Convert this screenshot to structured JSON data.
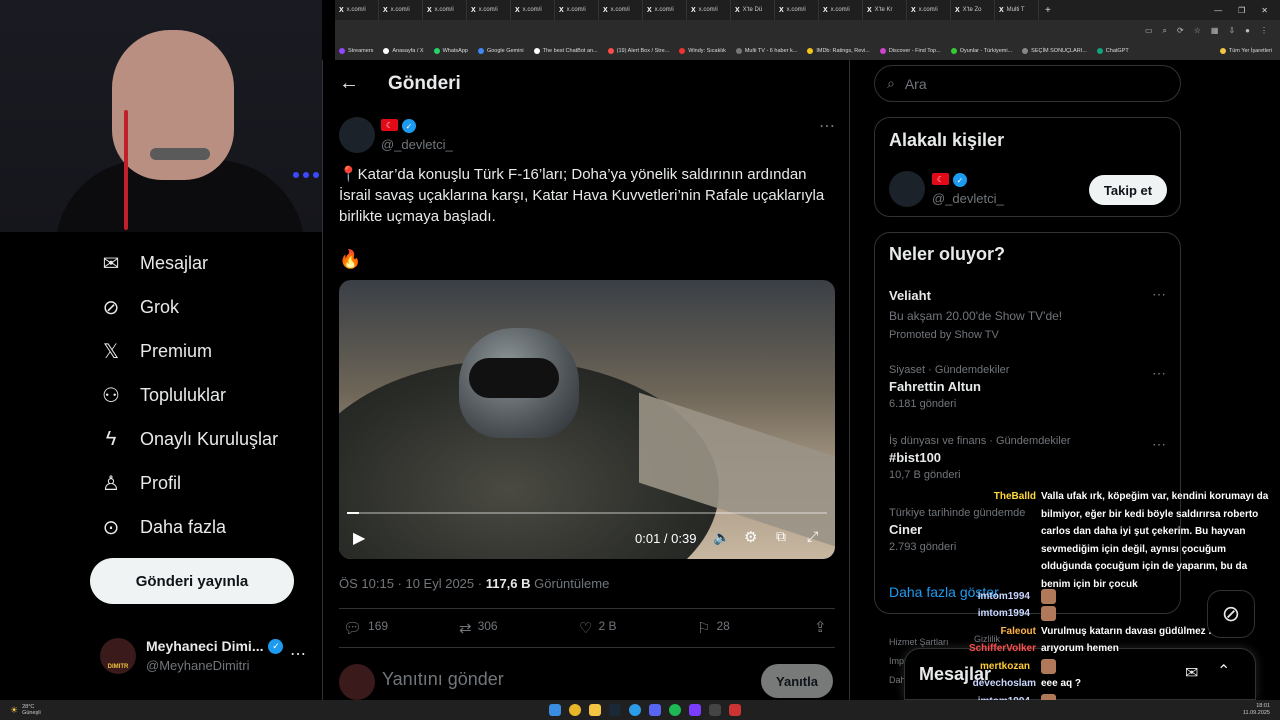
{
  "browser": {
    "tabs": [
      "x.com/i",
      "x.com/i",
      "x.com/i",
      "x.com/i",
      "x.com/i",
      "x.com/i",
      "x.com/i",
      "x.com/i",
      "x.com/i",
      "X'te Dü",
      "x.com/i",
      "x.com/i",
      "X'te Kr",
      "x.com/i",
      "X'te Zo",
      "Multi T"
    ],
    "bookmarks": [
      "Streamers",
      "Anasayfa / X",
      "WhatsApp",
      "Google Gemini",
      "The best ChatBot an...",
      "(19) Alert Box / Stre...",
      "Windy: Sıcaklık",
      "Multi TV - 6 haber k...",
      "IMDb: Ratings, Revi...",
      "Discover - Find Top...",
      "Oyunlar - Türkiyemi...",
      "SEÇİM SONUÇLARI...",
      "ChatGPT",
      "Tüm Yer İşaretleri"
    ]
  },
  "nav": {
    "items": [
      {
        "label": "Mesajlar",
        "icon": "envelope-icon"
      },
      {
        "label": "Grok",
        "icon": "grok-icon"
      },
      {
        "label": "Premium",
        "icon": "x-logo-icon"
      },
      {
        "label": "Topluluklar",
        "icon": "communities-icon"
      },
      {
        "label": "Onaylı Kuruluşlar",
        "icon": "lightning-icon"
      },
      {
        "label": "Profil",
        "icon": "person-icon"
      },
      {
        "label": "Daha fazla",
        "icon": "more-circle-icon"
      }
    ],
    "post_button": "Gönderi yayınla",
    "profile": {
      "name": "Meyhaneci Dimi...",
      "handle": "@MeyhaneDimitri",
      "avatar_text": "DIMITR"
    }
  },
  "main": {
    "header_title": "Gönderi",
    "tweet": {
      "handle": "@_devletci_",
      "text": "📍Katar’da konuşlu Türk F-16’ları; Doha’ya yönelik saldırının ardından İsrail savaş uçaklarına karşı, Katar Hava Kuvvetleri’nin Rafale uçaklarıyla birlikte uçmaya başladı.",
      "emoji": "🔥",
      "video_time": "0:01 / 0:39",
      "video_progress": 0.026,
      "meta_time": "ÖS 10:15 · 10 Eyl 2025 · ",
      "views_count": "117,6 B",
      "views_label": " Görüntüleme",
      "actions": {
        "replies": "169",
        "retweets": "306",
        "likes": "2 B",
        "bookmarks": "28"
      }
    },
    "reply_placeholder": "Yanıtını gönder",
    "reply_button": "Yanıtla"
  },
  "right": {
    "search_placeholder": "Ara",
    "related_title": "Alakalı kişiler",
    "related_handle": "@_devletci_",
    "follow_button": "Takip et",
    "trends_title": "Neler oluyor?",
    "trends": [
      {
        "cat": "",
        "title": "Veliaht",
        "sub": "Bu akşam 20.00'de Show TV'de!",
        "promo": "Promoted by Show TV"
      },
      {
        "cat": "Siyaset · Gündemdekiler",
        "title": "Fahrettin Altun",
        "count": "6.181 gönderi"
      },
      {
        "cat": "İş dünyası ve finans · Gündemdekiler",
        "title": "#bist100",
        "count": "10,7 B gönderi"
      },
      {
        "cat": "Türkiye tarihinde gündemde",
        "title": "Ciner",
        "count": "2.793 gönderi"
      }
    ],
    "show_more": "Daha fazla göster",
    "footer": [
      "Hizmet Şartları",
      "Gizlilik",
      "Impr",
      "Dah"
    ],
    "messages_dock": "Mesajlar"
  },
  "chat": [
    {
      "user": "TheBalld",
      "color": "#ffd83d",
      "text": "Valla ufak ırk, köpeğim var, kendini korumayı da bilmiyor, eğer bir kedi böyle saldırırsa roberto carlos dan daha iyi şut çekerim. Bu hayvan sevmediğim için değil, aynısı çocuğum olduğunda çocuğum için de yaparım, bu da benim için bir çocuk"
    },
    {
      "user": "imtom1994",
      "color": "#c9d6ff",
      "text": ""
    },
    {
      "user": "imtom1994",
      "color": "#c9d6ff",
      "text": ""
    },
    {
      "user": "Faleout",
      "color": "#ffb347",
      "text": "Vurulmuş katarın davası güdülmez ."
    },
    {
      "user": "SchifferVolker",
      "color": "#ff4d4d",
      "text": "arıyorum hemen"
    },
    {
      "user": "mertkozan",
      "color": "#ffcc33",
      "text": ""
    },
    {
      "user": "devechoslam",
      "color": "#c9d6ff",
      "text": "eee aq ?"
    },
    {
      "user": "imtom1994",
      "color": "#c9d6ff",
      "text": ""
    }
  ],
  "taskbar": {
    "weather_temp": "28°C",
    "weather_label": "Güneşli",
    "time": "18:01",
    "date": "11.09.2025"
  }
}
